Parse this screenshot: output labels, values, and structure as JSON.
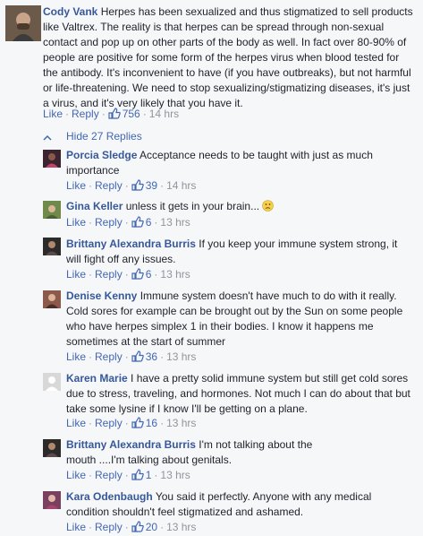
{
  "main": {
    "name": "Cody Vank",
    "text": "Herpes has been sexualized and thus stigmatized to sell products like Valtrex. The reality is that herpes can be spread through non-sexual contact and pop up on other parts of the body as well. In fact over 80-90% of people are positive for some form of the herpes virus when blood tested for the antibody. It's inconvenient to have (if you have outbreaks), but not harmful or life-threatening. We need to stop sexualizing/stigmatizing diseases, it's just a virus, and it's very likely that you have it.",
    "like_label": "Like",
    "reply_label": "Reply",
    "likes": "756",
    "time": "14 hrs"
  },
  "hide_replies_label": "Hide 27 Replies",
  "replies": [
    {
      "name": "Porcia Sledge",
      "text": "Acceptance needs to be taught with just as much importance",
      "like_label": "Like",
      "reply_label": "Reply",
      "likes": "39",
      "time": "14 hrs"
    },
    {
      "name": "Gina Keller",
      "text": "unless it gets in your brain...",
      "like_label": "Like",
      "reply_label": "Reply",
      "likes": "6",
      "time": "13 hrs"
    },
    {
      "name": "Brittany Alexandra Burris",
      "text": "If you keep your immune system strong, it will fight off any issues.",
      "like_label": "Like",
      "reply_label": "Reply",
      "likes": "6",
      "time": "13 hrs"
    },
    {
      "name": "Denise Kenny",
      "text": "Immune system doesn't have much to do with it really. Cold sores for example can be brought out by the Sun on some people who have herpes simplex 1 in their bodies. I know it happens me sometimes at the start of summer",
      "like_label": "Like",
      "reply_label": "Reply",
      "likes": "36",
      "time": "13 hrs"
    },
    {
      "name": "Karen Marie",
      "text": "I have a pretty solid immune system but still get cold sores due to stress, traveling, and hormones. Not much I can do about that but take some lysine if I know I'll be getting on a plane.",
      "like_label": "Like",
      "reply_label": "Reply",
      "likes": "16",
      "time": "13 hrs"
    },
    {
      "name": "Brittany Alexandra Burris",
      "text": "I'm not talking about the mouth ....I'm talking about genitals.",
      "like_label": "Like",
      "reply_label": "Reply",
      "likes": "1",
      "time": "13 hrs"
    },
    {
      "name": "Kara Odenbaugh",
      "text": "You said it perfectly. Anyone with any medical condition shouldn't feel stigmatized and ashamed.",
      "like_label": "Like",
      "reply_label": "Reply",
      "likes": "20",
      "time": "13 hrs"
    }
  ],
  "icons": {
    "like": "thumbs-up-icon",
    "hide": "chevron-up-icon",
    "emoji": "slight-frown-emoji-icon"
  },
  "colors": {
    "link": "#4267b2",
    "name": "#365899",
    "meta": "#90949c",
    "background": "#f6f7f9",
    "text": "#1d2129"
  }
}
